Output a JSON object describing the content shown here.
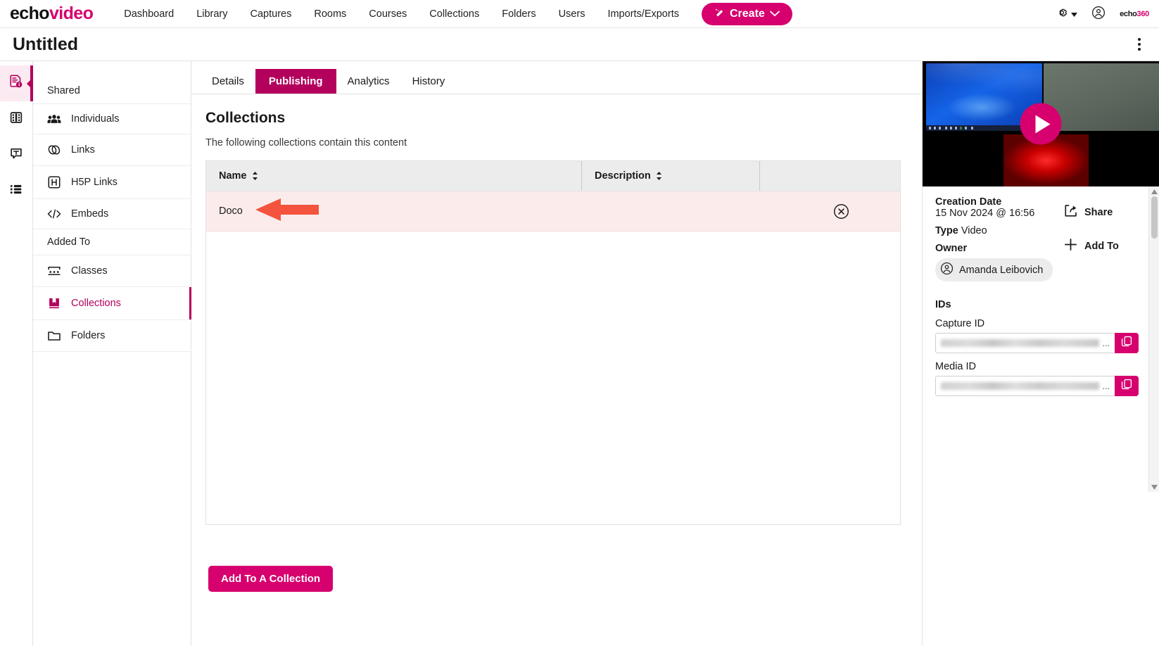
{
  "topnav": {
    "brand_echo": "echo",
    "brand_video": "video",
    "links": [
      {
        "label": "Dashboard"
      },
      {
        "label": "Library"
      },
      {
        "label": "Captures"
      },
      {
        "label": "Rooms"
      },
      {
        "label": "Courses"
      },
      {
        "label": "Collections"
      },
      {
        "label": "Folders"
      },
      {
        "label": "Users"
      },
      {
        "label": "Imports/Exports"
      }
    ],
    "create_label": "Create",
    "mini_logo_a": "echo",
    "mini_logo_b": "360",
    "accent": "#d6006e"
  },
  "titlebar": {
    "title": "Untitled"
  },
  "rail": {
    "items": [
      {
        "name": "details-info-icon",
        "active": true
      },
      {
        "name": "film-strip-icon",
        "active": false
      },
      {
        "name": "transcript-icon",
        "active": false
      },
      {
        "name": "list-icon",
        "active": false
      }
    ]
  },
  "tabs": [
    {
      "label": "Details",
      "active": false
    },
    {
      "label": "Publishing",
      "active": true
    },
    {
      "label": "Analytics",
      "active": false
    },
    {
      "label": "History",
      "active": false
    }
  ],
  "subnav": {
    "group_shared": "Shared",
    "group_added_to": "Added To",
    "shared_items": [
      {
        "label": "Individuals",
        "icon": "people-icon"
      },
      {
        "label": "Links",
        "icon": "link-icon"
      },
      {
        "label": "H5P Links",
        "icon": "h5p-icon"
      },
      {
        "label": "Embeds",
        "icon": "code-icon"
      }
    ],
    "added_items": [
      {
        "label": "Classes",
        "icon": "classroom-icon",
        "active": false
      },
      {
        "label": "Collections",
        "icon": "book-icon",
        "active": true
      },
      {
        "label": "Folders",
        "icon": "folder-icon",
        "active": false
      }
    ]
  },
  "main": {
    "heading": "Collections",
    "subheading": "The following collections contain this content",
    "columns": [
      "Name",
      "Description",
      ""
    ],
    "rows": [
      {
        "name": "Doco",
        "description": ""
      }
    ],
    "add_button": "Add To A Collection"
  },
  "rightpanel": {
    "creation_date_label": "Creation Date",
    "creation_date_value": "15 Nov 2024 @ 16:56",
    "type_label": "Type",
    "type_value": "Video",
    "owner_label": "Owner",
    "owner_name": "Amanda Leibovich",
    "ids_label": "IDs",
    "capture_id_label": "Capture ID",
    "capture_id_value": "",
    "media_id_label": "Media ID",
    "media_id_value": "",
    "share_label": "Share",
    "add_to_label": "Add To",
    "ellipsis": "..."
  }
}
